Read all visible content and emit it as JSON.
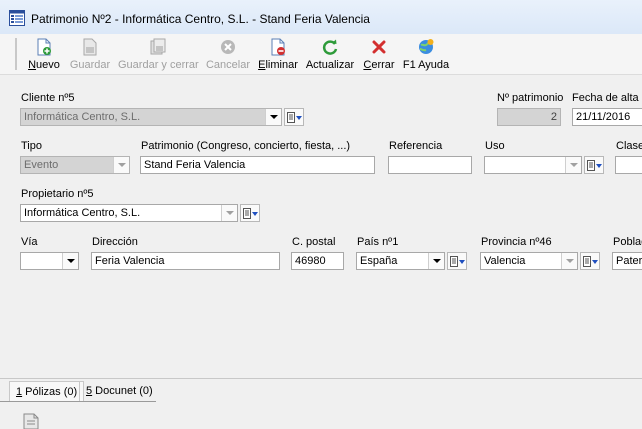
{
  "window": {
    "title": "Patrimonio Nº2 - Informática Centro, S.L. - Stand Feria Valencia"
  },
  "toolbar": {
    "buttons": [
      {
        "label_access": "N",
        "label_rest": "uevo",
        "icon": "new-document-icon",
        "enabled": true
      },
      {
        "label_access": "",
        "label_rest": "Guardar",
        "icon": "save-icon",
        "enabled": false
      },
      {
        "label_access": "",
        "label_rest": "Guardar y cerrar",
        "icon": "save-close-icon",
        "enabled": false
      },
      {
        "label_access": "",
        "label_rest": "Cancelar",
        "icon": "cancel-icon",
        "enabled": false
      },
      {
        "label_access": "E",
        "label_rest": "liminar",
        "icon": "delete-document-icon",
        "enabled": true
      },
      {
        "label_access": "",
        "label_rest": "Actualizar",
        "icon": "refresh-icon",
        "enabled": true
      },
      {
        "label_access": "C",
        "label_rest": "errar",
        "icon": "close-x-icon",
        "enabled": true
      },
      {
        "label_access": "",
        "label_rest": "F1 Ayuda",
        "icon": "help-globe-icon",
        "enabled": true
      }
    ]
  },
  "form": {
    "cliente": {
      "label": "Cliente nº5",
      "value": "Informática Centro, S.L."
    },
    "n_patrimonio": {
      "label": "Nº patrimonio",
      "value": "2"
    },
    "fecha_alta": {
      "label": "Fecha de alta",
      "value": "21/11/2016"
    },
    "tipo": {
      "label": "Tipo",
      "value": "Evento"
    },
    "patrimonio": {
      "label": "Patrimonio (Congreso, concierto, fiesta, ...)",
      "value": "Stand Feria Valencia"
    },
    "referencia": {
      "label": "Referencia",
      "value": ""
    },
    "uso": {
      "label": "Uso",
      "value": ""
    },
    "clase": {
      "label": "Clase",
      "value": ""
    },
    "propietario": {
      "label": "Propietario nº5",
      "value": "Informática Centro, S.L."
    },
    "via": {
      "label": "Vía",
      "value": ""
    },
    "direccion": {
      "label": "Dirección",
      "value": "Feria Valencia"
    },
    "cpostal": {
      "label": "C. postal",
      "value": "46980"
    },
    "pais": {
      "label": "País nº1",
      "value": "España"
    },
    "provincia": {
      "label": "Provincia nº46",
      "value": "Valencia"
    },
    "poblacion": {
      "label": "Poblac",
      "value": "Pater"
    }
  },
  "tabs": [
    {
      "key": "1",
      "label": " Pólizas (0)"
    },
    {
      "key": "5",
      "label": " Docunet (0)"
    }
  ],
  "colors": {
    "accent_blue": "#1f4fbf",
    "delete_red": "#d32f2f",
    "refresh_green": "#2e9b3a",
    "disabled_gray": "#a0a0a0"
  }
}
